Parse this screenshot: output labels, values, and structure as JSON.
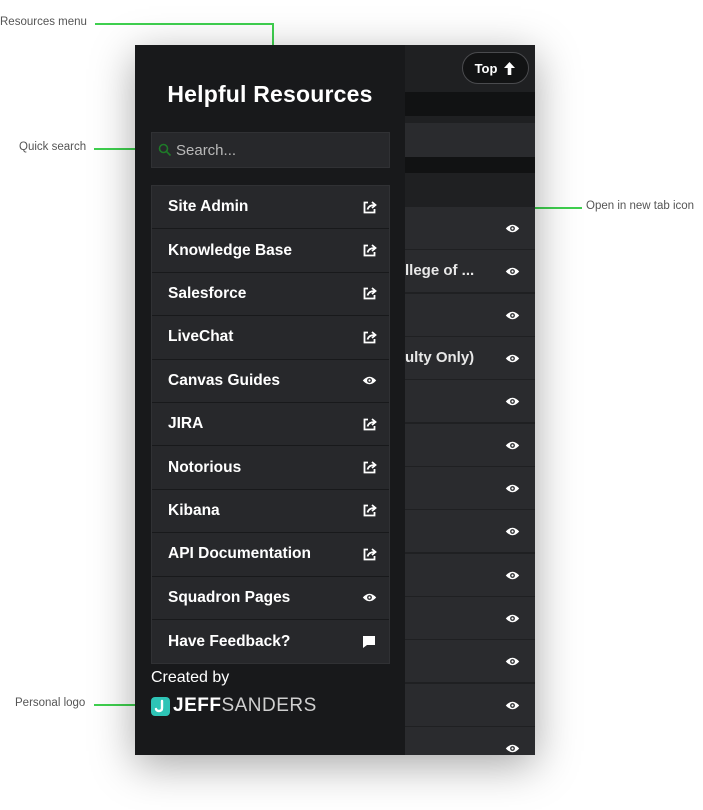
{
  "callouts": {
    "resources_menu": "Resources menu",
    "quick_search": "Quick search",
    "open_new_tab": "Open in new tab icon",
    "personal_logo": "Personal logo"
  },
  "sidebar": {
    "title": "Helpful Resources",
    "search_placeholder": "Search...",
    "items": [
      {
        "label": "Site Admin",
        "icon": "external-link-icon"
      },
      {
        "label": "Knowledge Base",
        "icon": "external-link-icon"
      },
      {
        "label": "Salesforce",
        "icon": "external-link-icon"
      },
      {
        "label": "LiveChat",
        "icon": "external-link-icon"
      },
      {
        "label": "Canvas Guides",
        "icon": "eye-icon"
      },
      {
        "label": "JIRA",
        "icon": "external-link-icon"
      },
      {
        "label": "Notorious",
        "icon": "external-link-icon"
      },
      {
        "label": "Kibana",
        "icon": "external-link-icon"
      },
      {
        "label": "API Documentation",
        "icon": "external-link-icon"
      },
      {
        "label": "Squadron Pages",
        "icon": "eye-icon"
      },
      {
        "label": "Have Feedback?",
        "icon": "chat-icon"
      }
    ],
    "created_by": "Created by",
    "logo_bold": "JEFF",
    "logo_light": "SANDERS"
  },
  "background": {
    "top_button": "Top",
    "row_texts": [
      "llege of ...",
      "ulty Only)"
    ]
  },
  "colors": {
    "accent": "#3fd04f",
    "panel": "#18191b",
    "item": "#27282b",
    "logo_teal": "#2ec4b6"
  }
}
